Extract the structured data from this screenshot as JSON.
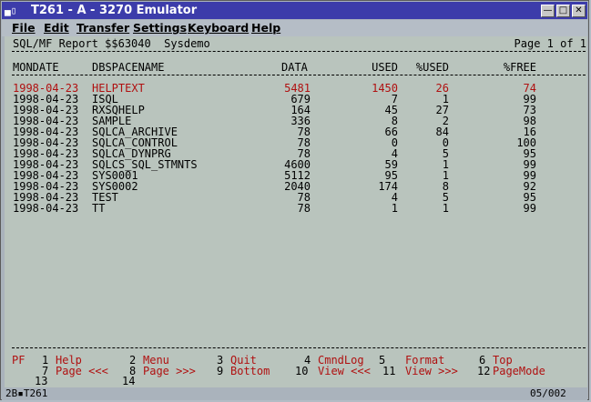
{
  "window": {
    "title": "T261 - A - 3270 Emulator",
    "sys_icon": "▄▯",
    "minimize": "—",
    "maximize": "□",
    "close": "✕"
  },
  "menu": [
    "File",
    "Edit",
    "Transfer",
    "Settings",
    "Keyboard",
    "Help"
  ],
  "report": {
    "title": "SQL/MF Report $$63040  Sysdemo",
    "page": "Page 1 of 1",
    "headers": {
      "mondate": "MONDATE",
      "dbspacename": "DBSPACENAME",
      "data": "DATA",
      "used": "USED",
      "pct_used": "%USED",
      "pct_free": "%FREE"
    },
    "rows": [
      {
        "mondate": "1998-04-23",
        "name": "HELPTEXT",
        "data": "5481",
        "used": "1450",
        "pct_used": "26",
        "pct_free": "74"
      },
      {
        "mondate": "1998-04-23",
        "name": "ISQL",
        "data": "679",
        "used": "7",
        "pct_used": "1",
        "pct_free": "99"
      },
      {
        "mondate": "1998-04-23",
        "name": "RXSQHELP",
        "data": "164",
        "used": "45",
        "pct_used": "27",
        "pct_free": "73"
      },
      {
        "mondate": "1998-04-23",
        "name": "SAMPLE",
        "data": "336",
        "used": "8",
        "pct_used": "2",
        "pct_free": "98"
      },
      {
        "mondate": "1998-04-23",
        "name": "SQLCA_ARCHIVE",
        "data": "78",
        "used": "66",
        "pct_used": "84",
        "pct_free": "16"
      },
      {
        "mondate": "1998-04-23",
        "name": "SQLCA_CONTROL",
        "data": "78",
        "used": "0",
        "pct_used": "0",
        "pct_free": "100"
      },
      {
        "mondate": "1998-04-23",
        "name": "SQLCA_DYNPRG",
        "data": "78",
        "used": "4",
        "pct_used": "5",
        "pct_free": "95"
      },
      {
        "mondate": "1998-04-23",
        "name": "SQLCS_SQL_STMNTS",
        "data": "4600",
        "used": "59",
        "pct_used": "1",
        "pct_free": "99"
      },
      {
        "mondate": "1998-04-23",
        "name": "SYS0001",
        "data": "5112",
        "used": "95",
        "pct_used": "1",
        "pct_free": "99"
      },
      {
        "mondate": "1998-04-23",
        "name": "SYS0002",
        "data": "2040",
        "used": "174",
        "pct_used": "8",
        "pct_free": "92"
      },
      {
        "mondate": "1998-04-23",
        "name": "TEST",
        "data": "78",
        "used": "4",
        "pct_used": "5",
        "pct_free": "95"
      },
      {
        "mondate": "1998-04-23",
        "name": "TT",
        "data": "78",
        "used": "1",
        "pct_used": "1",
        "pct_free": "99"
      }
    ]
  },
  "pfkeys": {
    "label": "PF",
    "row1": [
      {
        "num": "1",
        "label": "Help"
      },
      {
        "num": "2",
        "label": "Menu"
      },
      {
        "num": "3",
        "label": "Quit"
      },
      {
        "num": "4",
        "label": "CmndLog"
      },
      {
        "num": "5",
        "label": "Format"
      },
      {
        "num": "6",
        "label": "Top"
      }
    ],
    "row2": [
      {
        "num": "7",
        "label": "Page <<<"
      },
      {
        "num": "8",
        "label": "Page >>>"
      },
      {
        "num": "9",
        "label": "Bottom"
      },
      {
        "num": "10",
        "label": "View <<<"
      },
      {
        "num": "11",
        "label": "View >>>"
      },
      {
        "num": "12",
        "label": "PageMode"
      }
    ],
    "row3": [
      "13",
      "14"
    ]
  },
  "status": {
    "left": "2B▪T261",
    "right": "05/002"
  }
}
